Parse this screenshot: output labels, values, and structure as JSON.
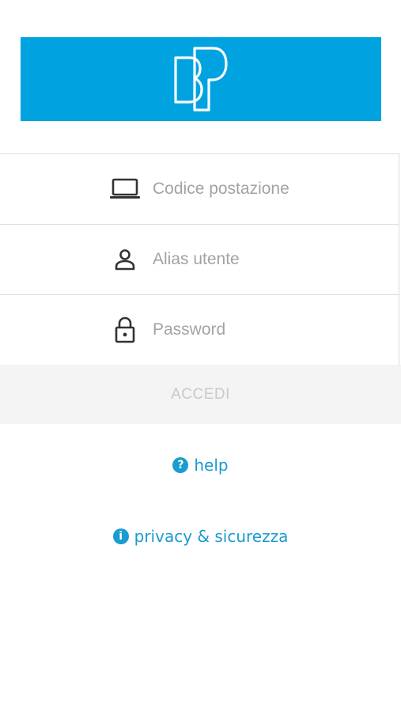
{
  "brand": {
    "banner_color": "#00a3e0",
    "logo_icon": "bp-logo"
  },
  "login_form": {
    "fields": [
      {
        "id": "workstation",
        "icon": "laptop-icon",
        "placeholder": "Codice postazione",
        "value": ""
      },
      {
        "id": "alias",
        "icon": "user-icon",
        "placeholder": "Alias utente",
        "value": ""
      },
      {
        "id": "password",
        "icon": "lock-icon",
        "placeholder": "Password",
        "value": ""
      }
    ],
    "submit_label": "ACCEDI"
  },
  "links": {
    "help": {
      "icon": "question-circle-icon",
      "glyph": "?",
      "label": "help"
    },
    "privacy": {
      "icon": "info-circle-icon",
      "glyph": "i",
      "label": "privacy & sicurezza"
    }
  },
  "colors": {
    "accent": "#1a9bd1",
    "placeholder": "#a3a3a3",
    "disabled_button_bg": "#f4f4f4",
    "disabled_button_text": "#c9c9c9"
  }
}
